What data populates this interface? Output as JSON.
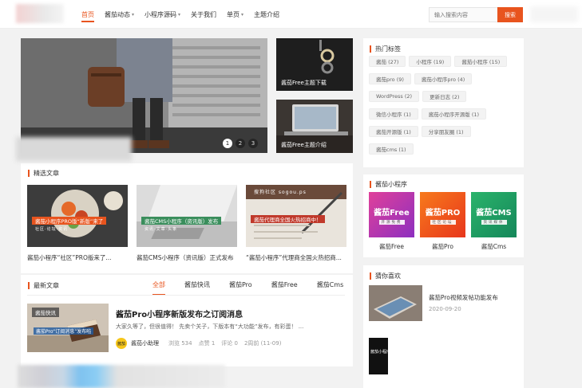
{
  "header": {
    "nav": [
      {
        "label": "首页",
        "active": true,
        "dropdown": false
      },
      {
        "label": "酱茄动态",
        "active": false,
        "dropdown": true
      },
      {
        "label": "小程序源码",
        "active": false,
        "dropdown": true
      },
      {
        "label": "关于我们",
        "active": false,
        "dropdown": false
      },
      {
        "label": "单页",
        "active": false,
        "dropdown": true
      },
      {
        "label": "主题介绍",
        "active": false,
        "dropdown": false
      }
    ],
    "search_placeholder": "输入搜索内容",
    "search_button": "搜索"
  },
  "slider": {
    "dots": [
      "1",
      "2",
      "3"
    ],
    "active_dot": 0
  },
  "side_thumbs": [
    {
      "caption": "酱茄Free主题下载"
    },
    {
      "caption": "酱茄Free主题介绍"
    }
  ],
  "featured": {
    "title": "精选文章",
    "items": [
      {
        "title": "酱茄小程序“社区”PRO版来了...",
        "banner": "酱茄小程序PRO版“新版”来了",
        "banner_sub": "社区·论坛·资讯"
      },
      {
        "title": "酱茄CMS小程序（资讯版）正式发布",
        "banner": "酱茄CMS小程序（资讯版）发布",
        "banner_sub": "资讯·文章·头条"
      },
      {
        "title": "“酱茄小程序”代理商全国火热招商...",
        "banner": "酱茄代理商全国火热招商中！",
        "banner_sub": "搜狗社区 sogou.ps"
      }
    ]
  },
  "latest": {
    "title": "最新文章",
    "tabs": [
      "全部",
      "酱茄快讯",
      "酱茄Pro",
      "酱茄Free",
      "酱茄Cms"
    ],
    "active_tab": 0,
    "post": {
      "badge": "酱茄快讯",
      "thumb_text": "酱茄Pro“订阅消息”发布啦",
      "title": "酱茄Pro小程序新版发布之订阅消息",
      "excerpt": "大家久等了，但很值得！ 先卖个关子，下版本有“大功能”发布，有彩蛋！ ...",
      "avatar_text": "酱茄",
      "author": "酱茄小助理",
      "views": "浏览 534",
      "likes": "点赞 1",
      "comments": "评论 0",
      "time": "2周前 (11-09)"
    }
  },
  "sidebar": {
    "hot_tags": {
      "title": "热门标签",
      "tags": [
        "酱茄 (27)",
        "小程序 (19)",
        "酱茄小程序 (15)",
        "酱茄pro (9)",
        "酱茄小程序pro (4)",
        "WordPress (2)",
        "更新日志 (2)",
        "微信小程序 (1)",
        "酱茄小程序开源版 (1)",
        "酱茄开源版 (1)",
        "分享朋友圈 (1)",
        "酱茄cms (1)"
      ]
    },
    "mini_programs": {
      "title": "酱茄小程序",
      "apps": [
        {
          "name": "酱茄Free",
          "tagline": "开源免费",
          "label": "酱茄Free",
          "color": "#c03aa8"
        },
        {
          "name": "酱茄PRO",
          "tagline": "社区论坛",
          "label": "酱茄Pro",
          "color": "#f05a18"
        },
        {
          "name": "酱茄CMS",
          "tagline": "资讯媒体",
          "label": "酱茄Cms",
          "color": "#1f9e5c"
        }
      ]
    },
    "guess": {
      "title": "猜你喜欢",
      "item_title": "酱茄Pro视频发帖功能发布",
      "item_date": "2020-09-20",
      "second_thumb_text": "酱茄小程序"
    }
  },
  "colors": {
    "accent": "#e8541e"
  }
}
